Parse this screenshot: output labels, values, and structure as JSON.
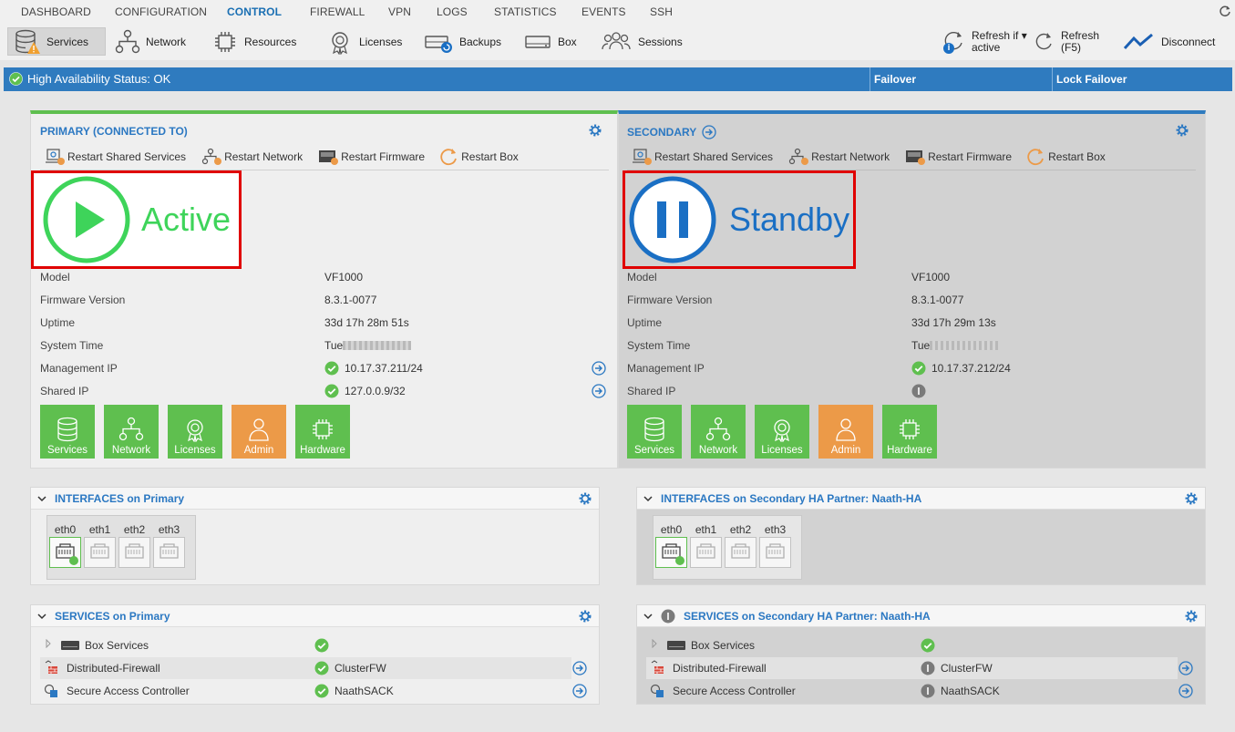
{
  "topnav": {
    "items": [
      "DASHBOARD",
      "CONFIGURATION",
      "CONTROL",
      "FIREWALL",
      "VPN",
      "LOGS",
      "STATISTICS",
      "EVENTS",
      "SSH"
    ],
    "active": "CONTROL"
  },
  "toolbar": {
    "services": "Services",
    "network": "Network",
    "resources": "Resources",
    "licenses": "Licenses",
    "backups": "Backups",
    "box": "Box",
    "sessions": "Sessions",
    "refresh_if_1": "Refresh if",
    "refresh_if_2": "active",
    "refresh_1": "Refresh",
    "refresh_2": "(F5)",
    "disconnect": "Disconnect"
  },
  "ha": {
    "status": "High Availability Status: OK",
    "failover": "Failover",
    "lock_failover": "Lock Failover"
  },
  "actions": {
    "restart_shared": "Restart Shared Services",
    "restart_network": "Restart Network",
    "restart_firmware": "Restart Firmware",
    "restart_box": "Restart Box"
  },
  "labels": {
    "model": "Model",
    "firmware": "Firmware Version",
    "uptime": "Uptime",
    "system_time": "System Time",
    "mgmt_ip": "Management IP",
    "shared_ip": "Shared IP"
  },
  "tiles": [
    "Services",
    "Network",
    "Licenses",
    "Admin",
    "Hardware"
  ],
  "primary": {
    "title": "PRIMARY (CONNECTED TO)",
    "state": "Active",
    "model": "VF1000",
    "firmware": "8.3.1-0077",
    "uptime": "33d 17h 28m 51s",
    "system_time": "Tue",
    "mgmt_ip": "10.17.37.211/24",
    "shared_ip": "127.0.0.9/32",
    "interfaces_title": "INTERFACES on Primary",
    "services_title": "SERVICES on Primary"
  },
  "secondary": {
    "title": "SECONDARY",
    "state": "Standby",
    "model": "VF1000",
    "firmware": "8.3.1-0077",
    "uptime": "33d 17h 29m 13s",
    "system_time": "Tue",
    "mgmt_ip": "10.17.37.212/24",
    "interfaces_title": "INTERFACES on Secondary HA Partner: Naath-HA",
    "services_title": "SERVICES on Secondary HA Partner: Naath-HA"
  },
  "ports": [
    "eth0",
    "eth1",
    "eth2",
    "eth3"
  ],
  "services": {
    "box": "Box Services",
    "firewall": "Distributed-Firewall",
    "firewall_val": "ClusterFW",
    "sac": "Secure Access Controller",
    "sac_val": "NaathSACK"
  },
  "colors": {
    "accent": "#2b78c2",
    "ha_bar": "#2f7bbf",
    "active": "#3ed45a",
    "standby": "#1a6fc4",
    "tile_green": "#5fbf4f",
    "tile_orange": "#ec9a48"
  }
}
